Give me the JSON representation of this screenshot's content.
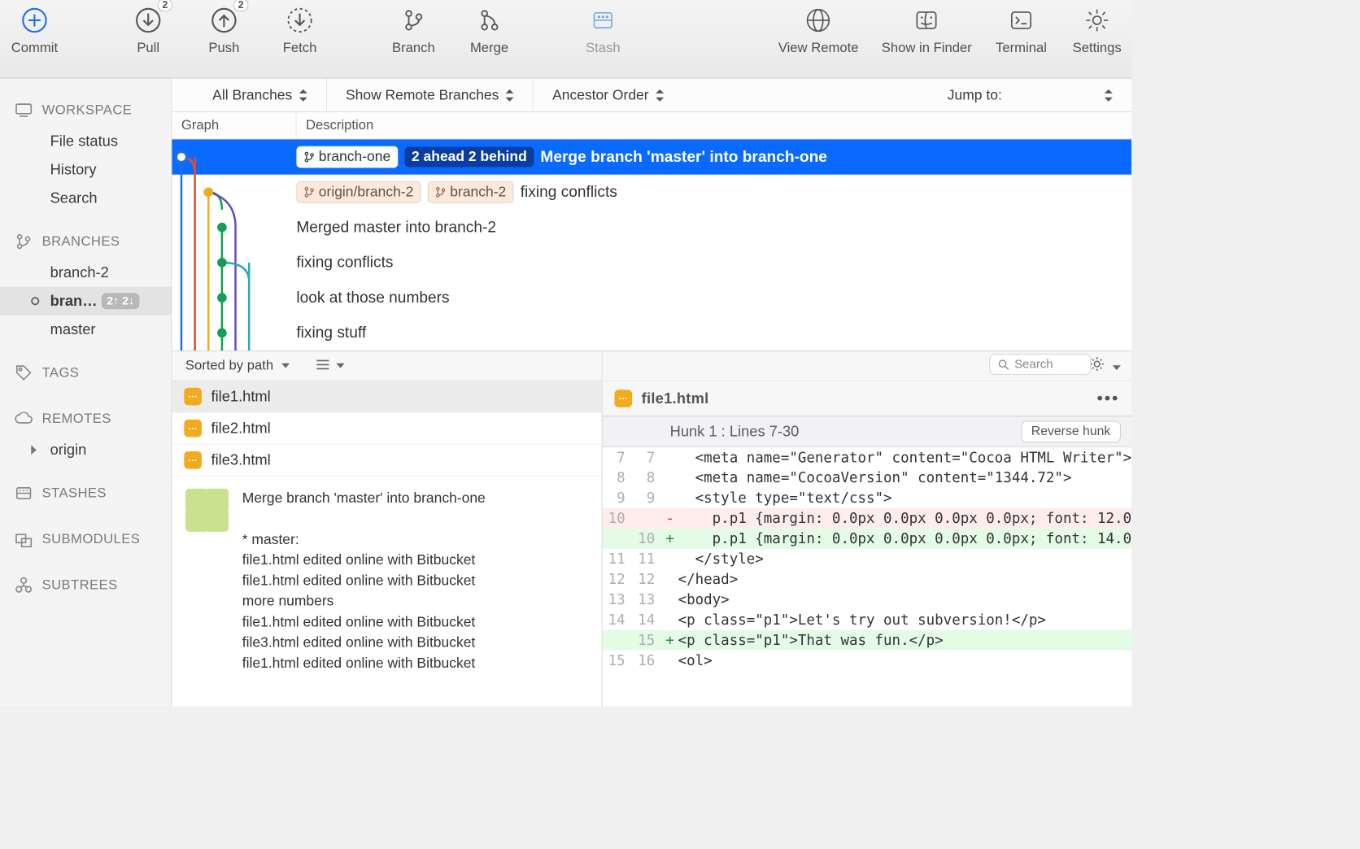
{
  "toolbar": {
    "commit": "Commit",
    "pull": "Pull",
    "pull_badge": "2",
    "push": "Push",
    "push_badge": "2",
    "fetch": "Fetch",
    "branch": "Branch",
    "merge": "Merge",
    "stash": "Stash",
    "view_remote": "View Remote",
    "show_in_finder": "Show in Finder",
    "terminal": "Terminal",
    "settings": "Settings"
  },
  "sidebar": {
    "workspace": {
      "header": "WORKSPACE",
      "items": [
        "File status",
        "History",
        "Search"
      ]
    },
    "branches": {
      "header": "BRANCHES",
      "items": [
        "branch-2",
        "bran…",
        "master"
      ],
      "selected_index": 1,
      "selected_pill": "2↑ 2↓"
    },
    "tags": {
      "header": "TAGS"
    },
    "remotes": {
      "header": "REMOTES",
      "items": [
        "origin"
      ]
    },
    "stashes": {
      "header": "STASHES"
    },
    "submodules": {
      "header": "SUBMODULES"
    },
    "subtrees": {
      "header": "SUBTREES"
    }
  },
  "filters": {
    "all_branches": "All Branches",
    "show_remote": "Show Remote Branches",
    "ancestor": "Ancestor Order",
    "jump_to": "Jump to:"
  },
  "table_header": {
    "graph": "Graph",
    "description": "Description"
  },
  "commits": [
    {
      "chips": [
        {
          "text": "branch-one",
          "status": "2 ahead 2 behind"
        }
      ],
      "msg": "Merge branch 'master' into branch-one",
      "selected": true
    },
    {
      "chips": [
        {
          "text": "origin/branch-2"
        },
        {
          "text": "branch-2"
        }
      ],
      "msg": "fixing conflicts"
    },
    {
      "msg": "Merged master into branch-2"
    },
    {
      "msg": "fixing conflicts"
    },
    {
      "msg": "look at those numbers"
    },
    {
      "msg": "fixing stuff"
    }
  ],
  "sortbar": {
    "label": "Sorted by path"
  },
  "search_placeholder": "Search",
  "files": [
    "file1.html",
    "file2.html",
    "file3.html"
  ],
  "selected_file": 0,
  "commit_message": "Merge branch 'master' into branch-one\n\n* master:\nfile1.html edited online with Bitbucket\nfile1.html edited online with Bitbucket\nmore numbers\nfile1.html edited online with Bitbucket\nfile3.html edited online with Bitbucket\nfile1.html edited online with Bitbucket",
  "diff": {
    "filename": "file1.html",
    "hunk_label": "Hunk 1 : Lines 7-30",
    "reverse_label": "Reverse hunk",
    "lines": [
      {
        "l": "7",
        "r": "7",
        "t": " ",
        "c": "  <meta name=\"Generator\" content=\"Cocoa HTML Writer\">"
      },
      {
        "l": "8",
        "r": "8",
        "t": " ",
        "c": "  <meta name=\"CocoaVersion\" content=\"1344.72\">"
      },
      {
        "l": "9",
        "r": "9",
        "t": " ",
        "c": "  <style type=\"text/css\">"
      },
      {
        "l": "10",
        "r": "",
        "t": "-",
        "c": "    p.p1 {margin: 0.0px 0.0px 0.0px 0.0px; font: 12.0"
      },
      {
        "l": "",
        "r": "10",
        "t": "+",
        "c": "    p.p1 {margin: 0.0px 0.0px 0.0px 0.0px; font: 14.0"
      },
      {
        "l": "11",
        "r": "11",
        "t": " ",
        "c": "  </style>"
      },
      {
        "l": "12",
        "r": "12",
        "t": " ",
        "c": "</head>"
      },
      {
        "l": "13",
        "r": "13",
        "t": " ",
        "c": "<body>"
      },
      {
        "l": "14",
        "r": "14",
        "t": " ",
        "c": "<p class=\"p1\">Let's try out subversion!</p>"
      },
      {
        "l": "",
        "r": "15",
        "t": "+",
        "c": "<p class=\"p1\">That was fun.</p>"
      },
      {
        "l": "15",
        "r": "16",
        "t": " ",
        "c": "<ol>"
      }
    ]
  }
}
